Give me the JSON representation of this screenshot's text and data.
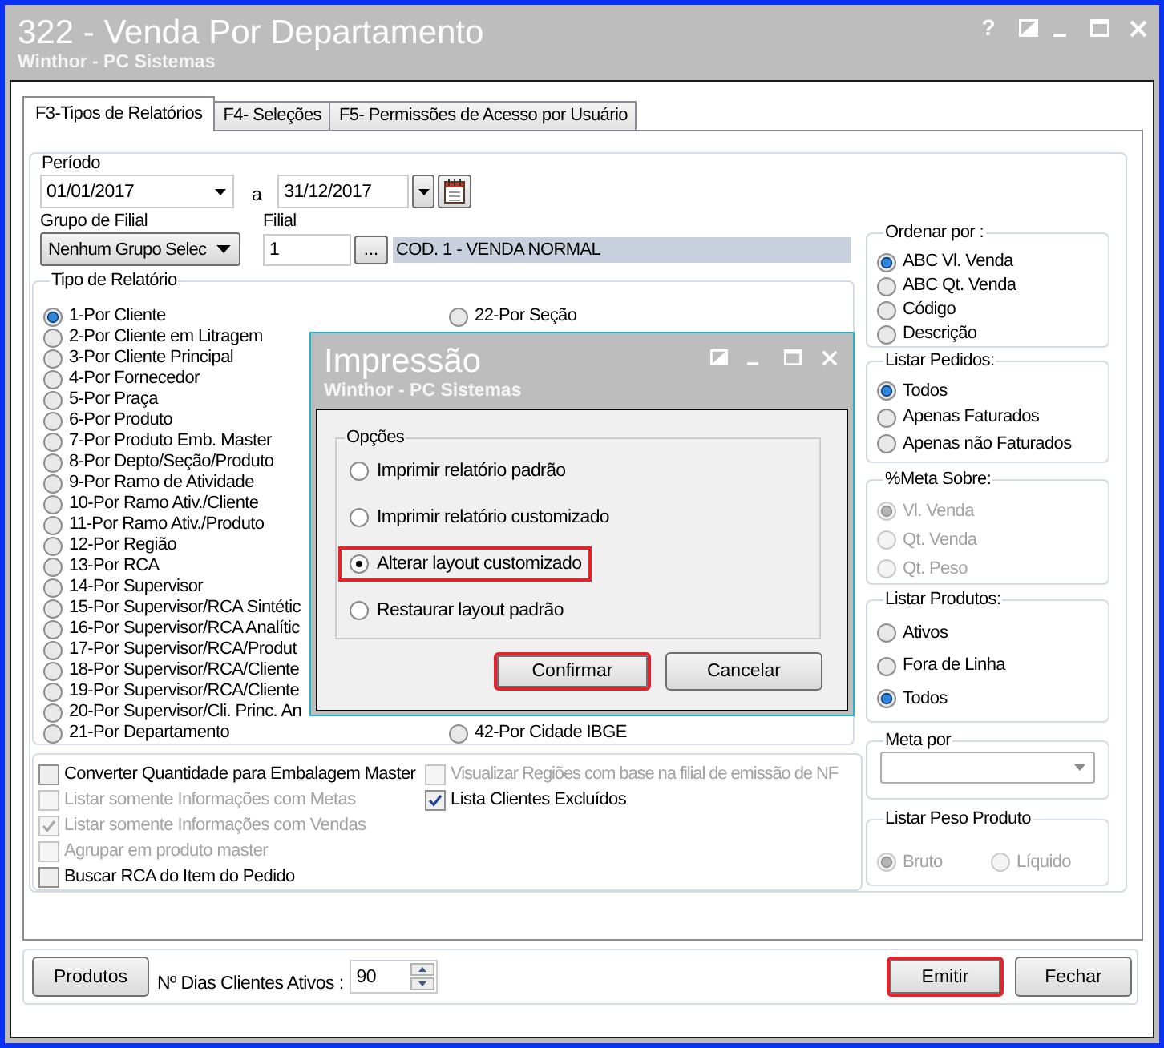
{
  "window": {
    "title": "322 - Venda Por Departamento",
    "subtitle": "Winthor - PC Sistemas",
    "help_button": "?"
  },
  "tabs": [
    {
      "label": "F3-Tipos de Relatórios",
      "selected": true
    },
    {
      "label": "F4- Seleções",
      "selected": false
    },
    {
      "label": "F5- Permissões de Acesso por Usuário",
      "selected": false
    }
  ],
  "period": {
    "label": "Período",
    "start": "01/01/2017",
    "separator": "a",
    "end": "31/12/2017"
  },
  "branch_group": {
    "label": "Grupo de Filial",
    "value": "Nenhum Grupo Selec"
  },
  "branch": {
    "label": "Filial",
    "code": "1",
    "lookup_button": "...",
    "description": "COD. 1 - VENDA NORMAL"
  },
  "report_type": {
    "title": "Tipo de Relatório",
    "column_1": [
      {
        "label": "1-Por Cliente",
        "selected": true
      },
      {
        "label": "2-Por Cliente em Litragem",
        "selected": false
      },
      {
        "label": "3-Por Cliente Principal",
        "selected": false
      },
      {
        "label": "4-Por Fornecedor",
        "selected": false
      },
      {
        "label": "5-Por Praça",
        "selected": false
      },
      {
        "label": "6-Por Produto",
        "selected": false
      },
      {
        "label": "7-Por Produto Emb. Master",
        "selected": false
      },
      {
        "label": "8-Por Depto/Seção/Produto",
        "selected": false
      },
      {
        "label": "9-Por Ramo de Atividade",
        "selected": false
      },
      {
        "label": "10-Por Ramo Ativ./Cliente",
        "selected": false
      },
      {
        "label": "11-Por Ramo Ativ./Produto",
        "selected": false
      },
      {
        "label": "12-Por Região",
        "selected": false
      },
      {
        "label": "13-Por RCA",
        "selected": false
      },
      {
        "label": "14-Por Supervisor",
        "selected": false
      },
      {
        "label": "15-Por Supervisor/RCA Sintétic",
        "selected": false
      },
      {
        "label": "16-Por Supervisor/RCA Analític",
        "selected": false
      },
      {
        "label": "17-Por Supervisor/RCA/Produt",
        "selected": false
      },
      {
        "label": "18-Por Supervisor/RCA/Cliente",
        "selected": false
      },
      {
        "label": "19-Por Supervisor/RCA/Cliente",
        "selected": false
      },
      {
        "label": "20-Por Supervisor/Cli. Princ. An",
        "selected": false
      },
      {
        "label": "21-Por Departamento",
        "selected": false
      }
    ],
    "column_2": [
      {
        "label": "22-Por Seção",
        "selected": false
      },
      {
        "label": "42-Por Cidade IBGE",
        "selected": false
      }
    ]
  },
  "options": {
    "column_1": [
      {
        "label": "Converter Quantidade para Embalagem Master",
        "checked": false,
        "disabled": false
      },
      {
        "label": "Listar somente Informações com Metas",
        "checked": false,
        "disabled": true
      },
      {
        "label": "Listar somente Informações com Vendas",
        "checked": true,
        "disabled": true
      },
      {
        "label": "Agrupar em produto master",
        "checked": false,
        "disabled": true
      },
      {
        "label": "Buscar RCA do Item do Pedido",
        "checked": false,
        "disabled": false
      }
    ],
    "column_2": [
      {
        "label": "Visualizar Regiões com base na filial de emissão de NF",
        "checked": false,
        "disabled": true
      },
      {
        "label": "Lista Clientes Excluídos",
        "checked": true,
        "disabled": false
      }
    ]
  },
  "right_groups": [
    {
      "kind": "radio",
      "title": "Ordenar por :",
      "disabled": false,
      "items": [
        {
          "label": "ABC Vl. Venda",
          "selected": true
        },
        {
          "label": "ABC Qt. Venda",
          "selected": false
        },
        {
          "label": "Código",
          "selected": false
        },
        {
          "label": "Descrição",
          "selected": false
        }
      ]
    },
    {
      "kind": "radio",
      "title": "Listar Pedidos:",
      "disabled": false,
      "items": [
        {
          "label": "Todos",
          "selected": true
        },
        {
          "label": "Apenas Faturados",
          "selected": false
        },
        {
          "label": "Apenas não Faturados",
          "selected": false
        }
      ]
    },
    {
      "kind": "radio",
      "title": "%Meta Sobre:",
      "disabled": true,
      "items": [
        {
          "label": "Vl. Venda",
          "selected": true
        },
        {
          "label": "Qt. Venda",
          "selected": false
        },
        {
          "label": "Qt. Peso",
          "selected": false
        }
      ]
    },
    {
      "kind": "radio",
      "title": "Listar Produtos:",
      "disabled": false,
      "items": [
        {
          "label": "Ativos",
          "selected": false
        },
        {
          "label": "Fora de Linha",
          "selected": false
        },
        {
          "label": "Todos",
          "selected": true
        }
      ]
    },
    {
      "kind": "combo",
      "title": "Meta por"
    },
    {
      "kind": "radio_row",
      "title": "Listar Peso Produto",
      "disabled": true,
      "items": [
        {
          "label": "Bruto",
          "selected": true
        },
        {
          "label": "Líquido",
          "selected": false
        }
      ]
    }
  ],
  "footer": {
    "products_button": "Produtos",
    "days_label": "Nº Dias Clientes Ativos :",
    "days_value": "90",
    "actions": [
      {
        "label": "Emitir",
        "highlighted": true
      },
      {
        "label": "Fechar",
        "highlighted": false
      }
    ]
  },
  "dialog": {
    "title": "Impressão",
    "subtitle": "Winthor - PC Sistemas",
    "group_title": "Opções",
    "options": [
      {
        "label": "Imprimir relatório padrão",
        "selected": false,
        "highlighted": false
      },
      {
        "label": "Imprimir relatório customizado",
        "selected": false,
        "highlighted": false
      },
      {
        "label": "Alterar layout customizado",
        "selected": true,
        "highlighted": true
      },
      {
        "label": "Restaurar layout padrão",
        "selected": false,
        "highlighted": false
      }
    ],
    "buttons": [
      {
        "label": "Confirmar",
        "highlighted": true
      },
      {
        "label": "Cancelar",
        "highlighted": false
      }
    ]
  }
}
